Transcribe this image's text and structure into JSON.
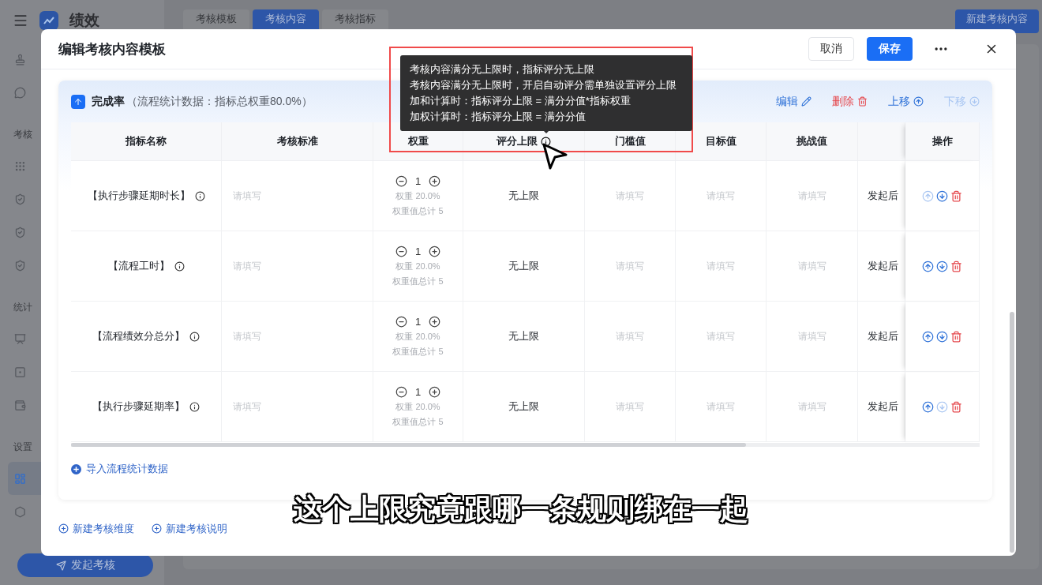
{
  "app": {
    "brand": "绩效",
    "tabs": [
      {
        "label": "考核模板",
        "selected": false
      },
      {
        "label": "考核内容",
        "selected": true
      },
      {
        "label": "考核指标",
        "selected": false
      }
    ],
    "new_button": "新建考核内容",
    "sidebar": {
      "groups": [
        {
          "items": [
            {
              "selected": false
            },
            {
              "selected": false
            }
          ]
        },
        {
          "title": "考核",
          "items": [
            {
              "selected": false
            },
            {
              "selected": false
            },
            {
              "selected": false
            },
            {
              "selected": false
            }
          ]
        },
        {
          "title": "统计",
          "items": [
            {
              "selected": false
            },
            {
              "selected": false
            },
            {
              "selected": false
            }
          ]
        },
        {
          "title": "设置",
          "items": [
            {
              "selected": true
            },
            {
              "selected": false
            }
          ]
        }
      ]
    },
    "launch_button": "发起考核"
  },
  "dialog": {
    "title": "编辑考核内容模板",
    "cancel": "取消",
    "save": "保存",
    "dimension": {
      "title": "完成率",
      "subtitle": "（流程统计数据：指标总权重80.0%）",
      "actions": [
        {
          "kind": "edit",
          "label": "编辑",
          "disabled": false
        },
        {
          "kind": "delete",
          "label": "删除",
          "disabled": false
        },
        {
          "kind": "up",
          "label": "上移",
          "disabled": false
        },
        {
          "kind": "down",
          "label": "下移",
          "disabled": true
        }
      ],
      "columns": [
        {
          "kind": "text",
          "label": "指标名称"
        },
        {
          "kind": "text",
          "label": "考核标准"
        },
        {
          "kind": "text",
          "label": "权重"
        },
        {
          "kind": "info",
          "label": "评分上限"
        },
        {
          "kind": "text",
          "label": "门槛值"
        },
        {
          "kind": "text",
          "label": "目标值"
        },
        {
          "kind": "text",
          "label": "挑战值"
        },
        {
          "kind": "cut"
        },
        {
          "kind": "text",
          "label": "操作"
        }
      ],
      "rows": [
        {
          "name": "【执行步骤延期时长】",
          "standard": {
            "placeholder": "请填写"
          },
          "weight": "1",
          "weight_percent": "权重 20.0%",
          "weight_total": "权重值总计 5",
          "limit": "无上限",
          "threshold": {
            "placeholder": "请填写"
          },
          "target": {
            "placeholder": "请填写"
          },
          "challenge": {
            "placeholder": "请填写"
          },
          "column_8": "发起后",
          "up_disabled": true,
          "down_disabled": false
        },
        {
          "name": "【流程工时】",
          "standard": {
            "placeholder": "请填写"
          },
          "weight": "1",
          "weight_percent": "权重 20.0%",
          "weight_total": "权重值总计 5",
          "limit": "无上限",
          "threshold": {
            "placeholder": "请填写"
          },
          "target": {
            "placeholder": "请填写"
          },
          "challenge": {
            "placeholder": "请填写"
          },
          "column_8": "发起后",
          "up_disabled": false,
          "down_disabled": false
        },
        {
          "name": "【流程绩效分总分】",
          "standard": {
            "placeholder": "请填写"
          },
          "weight": "1",
          "weight_percent": "权重 20.0%",
          "weight_total": "权重值总计 5",
          "limit": "无上限",
          "threshold": {
            "placeholder": "请填写"
          },
          "target": {
            "placeholder": "请填写"
          },
          "challenge": {
            "placeholder": "请填写"
          },
          "column_8": "发起后",
          "up_disabled": false,
          "down_disabled": false
        },
        {
          "name": "【执行步骤延期率】",
          "standard": {
            "placeholder": "请填写"
          },
          "weight": "1",
          "weight_percent": "权重 20.0%",
          "weight_total": "权重值总计 5",
          "limit": "无上限",
          "threshold": {
            "placeholder": "请填写"
          },
          "target": {
            "placeholder": "请填写"
          },
          "challenge": {
            "placeholder": "请填写"
          },
          "column_8": "发起后",
          "up_disabled": false,
          "down_disabled": true
        }
      ],
      "import_link": "导入流程统计数据"
    },
    "footer_links": [
      "新建考核维度",
      "新建考核说明"
    ]
  },
  "tooltip": {
    "lines": [
      "考核内容满分无上限时，指标评分无上限",
      "考核内容满分无上限时，开启自动评分需单独设置评分上限",
      "加和计算时：指标评分上限 = 满分分值*指标权重",
      "加权计算时：指标评分上限 = 满分分值"
    ]
  },
  "caption": "这个上限究竟跟哪一条规则绑在一起"
}
